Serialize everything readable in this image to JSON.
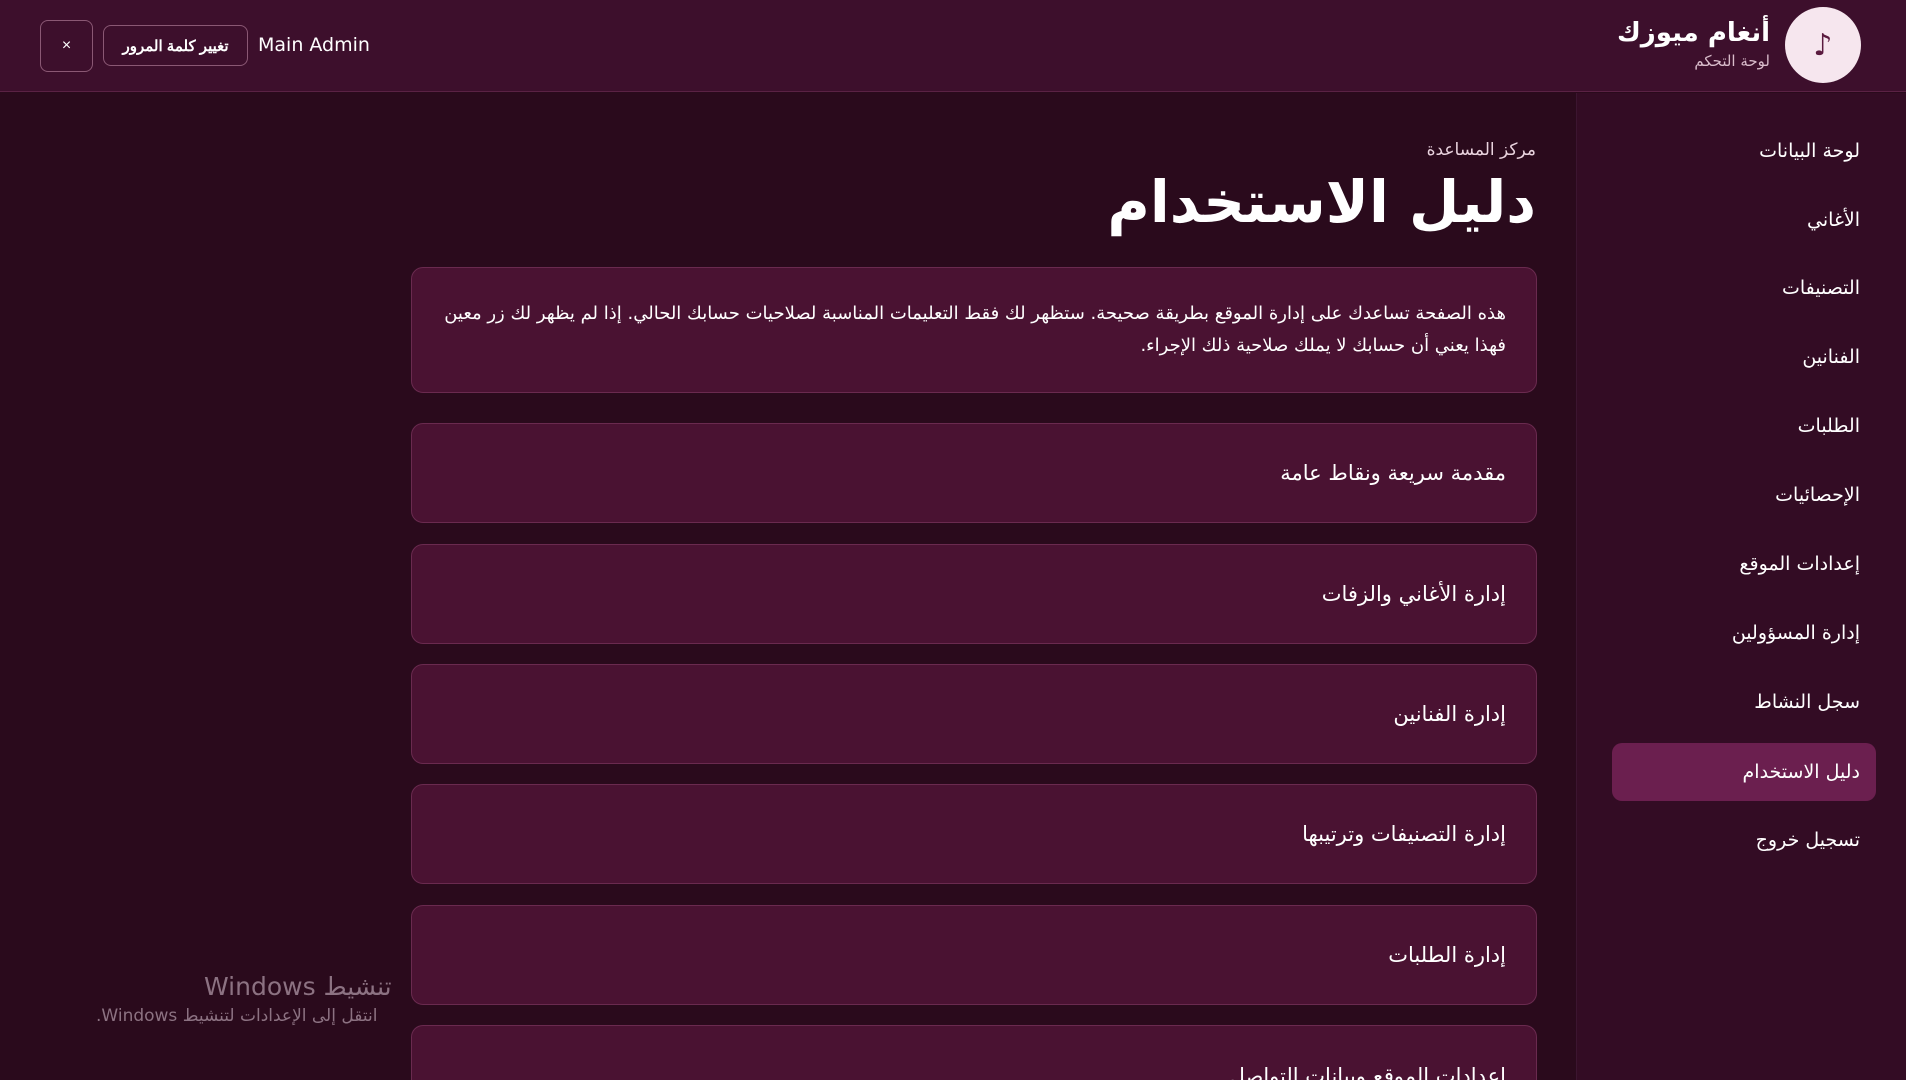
{
  "header": {
    "brand_name": "أنغام ميوزك",
    "brand_sub": "لوحة التحكم",
    "logo_icon": "music-note-icon",
    "logo_glyph": "♪",
    "admin_name": "Main Admin",
    "change_password_label": "تغيير كلمة المرور",
    "close_label": "×"
  },
  "sidebar": {
    "items": [
      {
        "label": "لوحة البيانات"
      },
      {
        "label": "الأغاني"
      },
      {
        "label": "التصنيفات"
      },
      {
        "label": "الفنانين"
      },
      {
        "label": "الطلبات"
      },
      {
        "label": "الإحصائيات"
      },
      {
        "label": "إعدادات الموقع"
      },
      {
        "label": "إدارة المسؤولين"
      },
      {
        "label": "سجل النشاط"
      },
      {
        "label": "دليل الاستخدام",
        "active": true
      },
      {
        "label": "تسجيل خروج"
      }
    ]
  },
  "main": {
    "breadcrumb": "مركز المساعدة",
    "title": "دليل الاستخدام",
    "intro": "هذه الصفحة تساعدك على إدارة الموقع بطريقة صحيحة. ستظهر لك فقط التعليمات المناسبة لصلاحيات حسابك الحالي. إذا لم يظهر لك زر معين فهذا يعني أن حسابك لا يملك صلاحية ذلك الإجراء.",
    "sections": [
      {
        "title": "مقدمة سريعة ونقاط عامة"
      },
      {
        "title": "إدارة الأغاني والزفات"
      },
      {
        "title": "إدارة الفنانين"
      },
      {
        "title": "إدارة التصنيفات وترتيبها"
      },
      {
        "title": "إدارة الطلبات"
      },
      {
        "title": "إعدادات الموقع وبيانات التواصل"
      }
    ]
  },
  "watermark": {
    "title": "تنشيط Windows",
    "subtitle": "انتقل إلى الإعدادات لتنشيط Windows."
  },
  "colors": {
    "background": "#2a0a1c",
    "topbar": "#3d0f2c",
    "card": "#4a1232",
    "active_nav": "#6b1f4f"
  }
}
